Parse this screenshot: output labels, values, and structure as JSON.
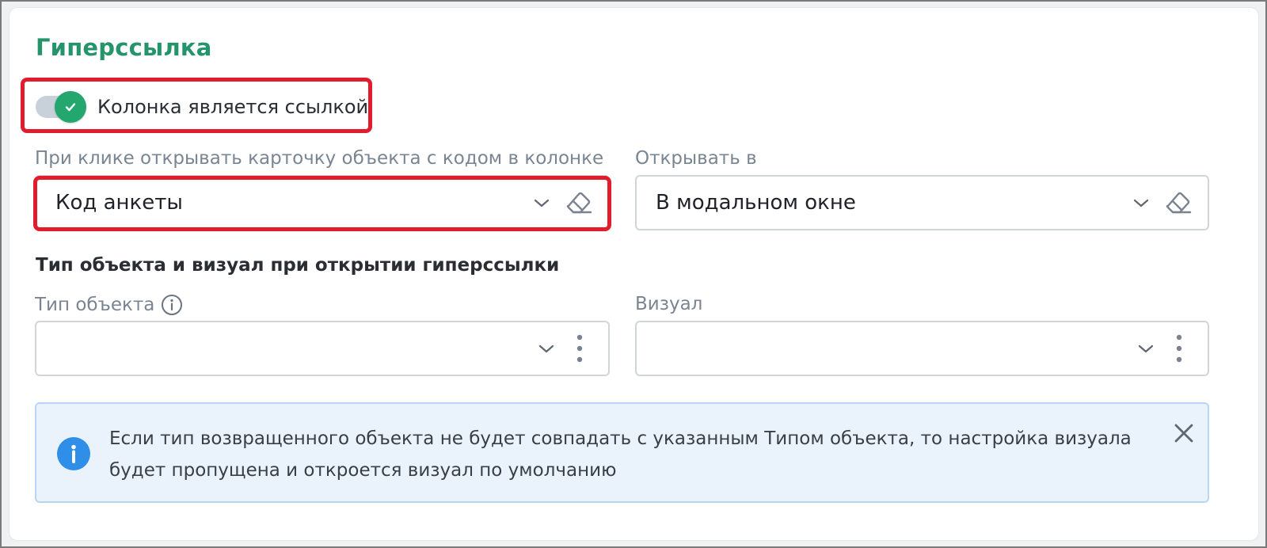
{
  "section": {
    "title": "Гиперссылка"
  },
  "toggle": {
    "label": "Колонка является ссылкой",
    "checked": true
  },
  "fields": {
    "object_card": {
      "label": "При клике открывать карточку объекта с кодом в колонке",
      "value": "Код анкеты"
    },
    "open_in": {
      "label": "Открывать в",
      "value": "В модальном окне"
    },
    "object_type": {
      "label": "Тип объекта",
      "value": ""
    },
    "visual": {
      "label": "Визуал",
      "value": ""
    }
  },
  "group": {
    "title": "Тип объекта и визуал при открытии гиперссылки"
  },
  "alert": {
    "text": "Если тип возвращенного объекта не будет совпадать с указанным Типом объекта, то настройка визуала будет пропущена и откроется визуал по умолчанию"
  },
  "icons": {
    "toggle_check": "check-icon",
    "chevron": "chevron-down-icon",
    "eraser": "eraser-icon",
    "kebab": "more-vertical-icon",
    "info": "info-icon",
    "close": "close-icon"
  },
  "colors": {
    "accent_green": "#25946b",
    "toggle_green": "#23a76e",
    "highlight_red": "#e01c2d",
    "info_blue": "#2f8fe8",
    "alert_bg": "#eaf3fc"
  }
}
